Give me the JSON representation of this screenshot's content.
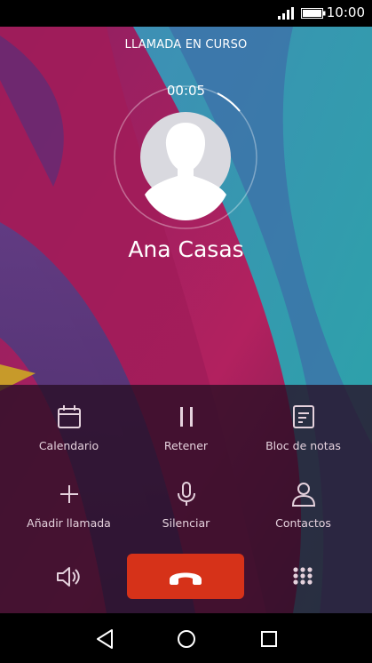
{
  "status_bar": {
    "time": "10:00"
  },
  "call": {
    "state": "LLAMADA EN CURSO",
    "duration": "00:05",
    "contact_name": "Ana Casas"
  },
  "controls": {
    "calendar_label": "Calendario",
    "hold_label": "Retener",
    "notes_label": "Bloc de notas",
    "add_call_label": "Añadir llamada",
    "mute_label": "Silenciar",
    "contacts_label": "Contactos"
  },
  "colors": {
    "end_call": "#d63219",
    "label_text": "#e5d2dd"
  }
}
